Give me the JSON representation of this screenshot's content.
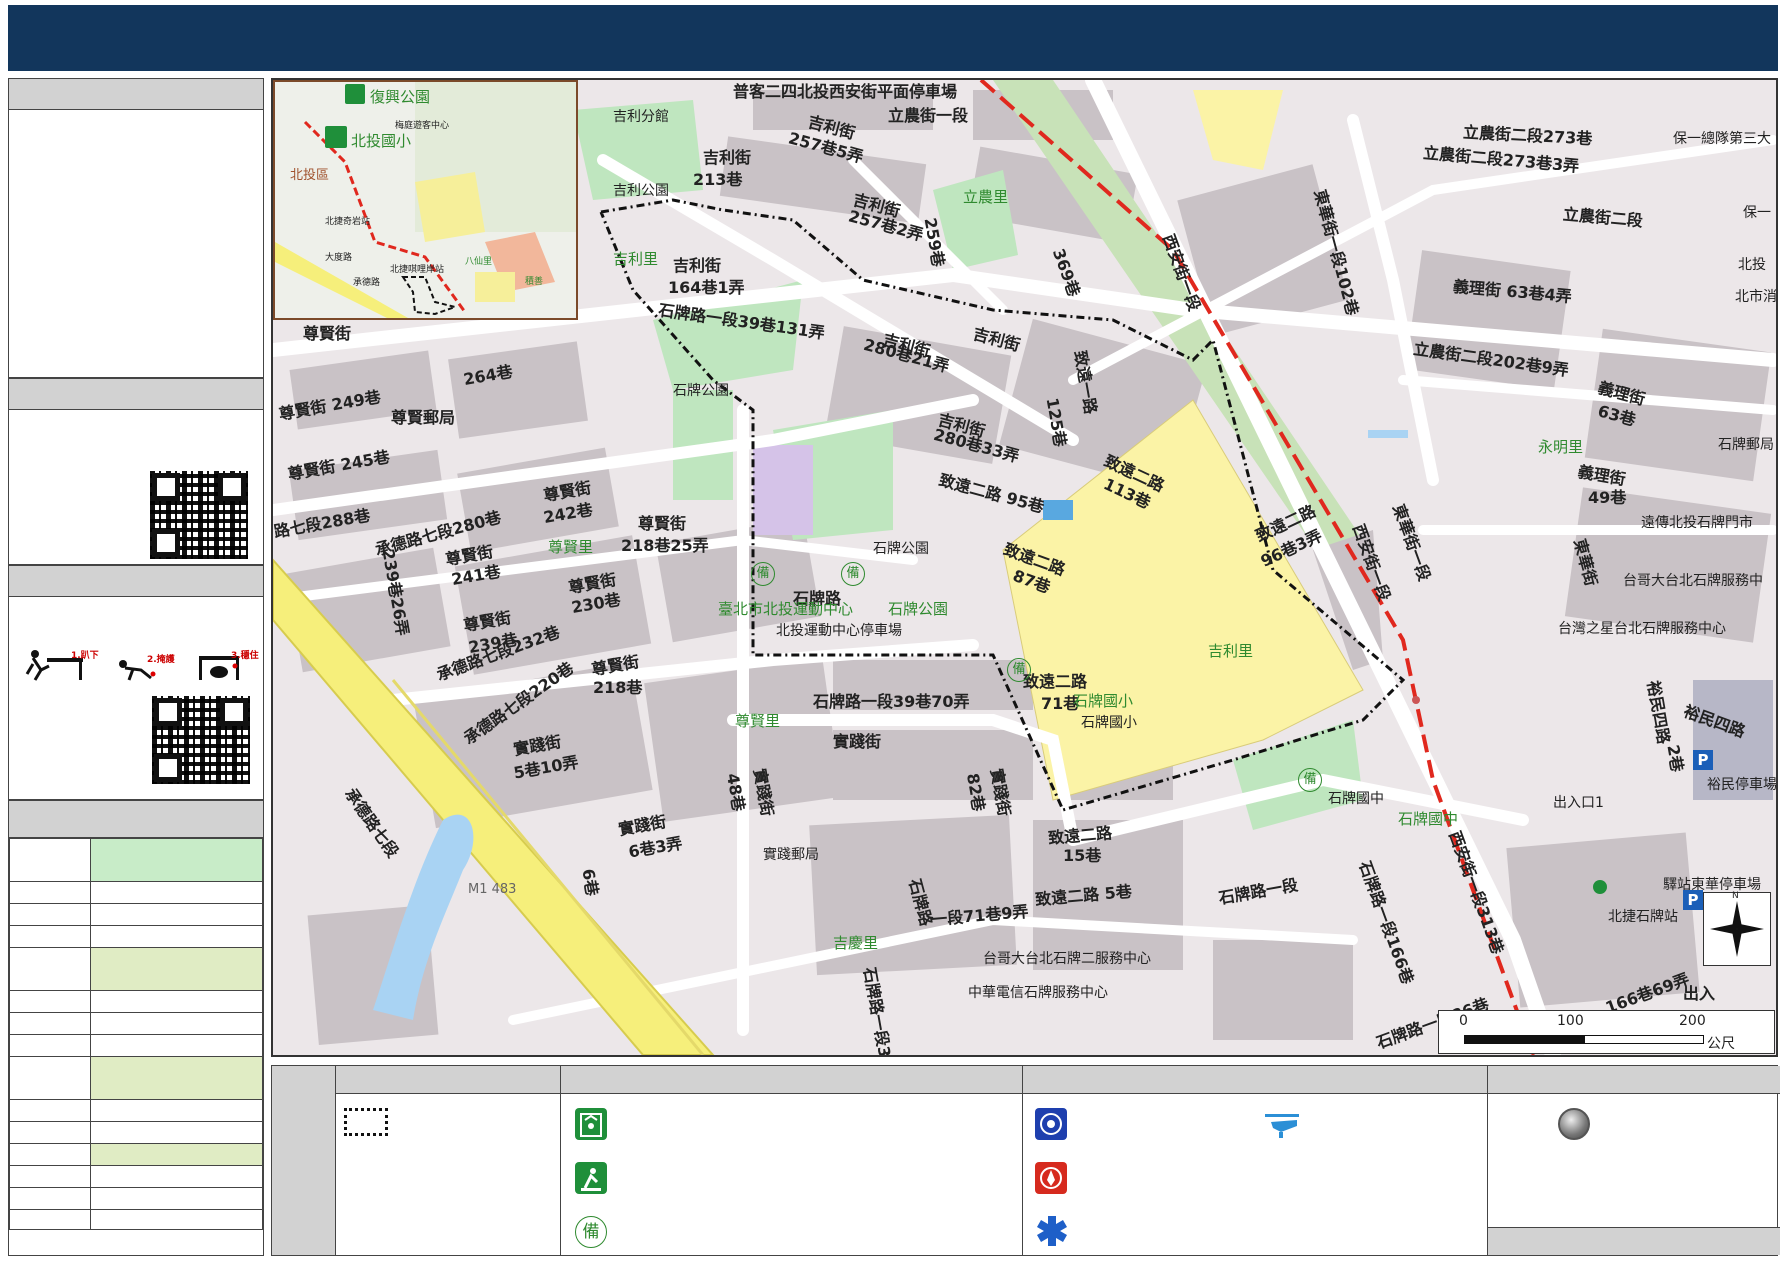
{
  "colors": {
    "header_bar": "#12365c",
    "panel_head": "#d2d2d2",
    "road_yellow": "#f6ef7b",
    "block_gray": "#c9c2c6",
    "school_yellow": "#fbf3a6",
    "park_green": "#bfe6bf",
    "route_red": "#e0281e",
    "shelter_green": "#1f8f3a",
    "police_blue": "#1e3fae",
    "fire_red": "#d62a1e",
    "schedule_green": "#c8ecc8",
    "schedule_olive": "#e0ecc4"
  },
  "icons": {
    "shelter": "shelter-icon",
    "park": "park-icon",
    "standby": "standby-icon",
    "police": "police-icon",
    "fire": "fire-icon",
    "medical": "medical-icon",
    "helicopter": "helicopter-icon",
    "gate": "exit-gate-icon",
    "compass": "north-arrow-icon",
    "parking": "parking-icon"
  },
  "drill_steps": [
    "1.趴下",
    "2.掩護",
    "3.穩住"
  ],
  "inset": {
    "labels": [
      "復興公園",
      "北投國小",
      "北投區",
      "北捷奇岩站",
      "大度路",
      "北捷唭哩岸站",
      "承德路",
      "八仙里",
      "積善",
      "梅庭遊客中心"
    ]
  },
  "map": {
    "scale": {
      "ticks": [
        "0",
        "100",
        "200"
      ],
      "unit": "公尺"
    },
    "compass_letter": "N",
    "labels": {
      "street": [
        "普客二四北投西安街平面停車場",
        "立農街一段",
        "吉利街",
        "257巷5弄",
        "吉利街",
        "213巷",
        "吉利街",
        "257巷2弄",
        "259巷",
        "立農里",
        "吉利里",
        "吉利街",
        "164巷1弄",
        "石牌路一段39巷131弄",
        "吉利街",
        "280巷21弄",
        "吉利街",
        "369巷",
        "致遠一路",
        "125巷",
        "尊賢街",
        "264巷",
        "尊賢街 249巷",
        "尊賢郵局",
        "尊賢街 245巷",
        "路七段288巷",
        "承德路七段280巷",
        "尊賢街",
        "241巷",
        "尊賢街",
        "242巷",
        "尊賢街",
        "218巷25弄",
        "尊賢里",
        "尊賢街",
        "230巷",
        "239巷26弄",
        "尊賢街",
        "239巷",
        "承德路七段232巷",
        "承德路七段220巷",
        "尊賢街",
        "218巷",
        "實踐街",
        "5巷10弄",
        "尊賢里",
        "實踐街",
        "6巷3弄",
        "實踐街",
        "48巷",
        "實踐郵局",
        "6巷",
        "吉慶里",
        "實踐街",
        "石牌路一段39巷70弄",
        "實踐街",
        "82巷",
        "致遠二路",
        "15巷",
        "致遠二路 5巷",
        "石牌路",
        "一段71巷9弄",
        "台哥大台北石牌二服務中心",
        "中華電信石牌服務中心",
        "石牌路一段3",
        "承德路七段",
        "M1 483",
        "吉利街",
        "280巷33弄",
        "致遠二路 95巷",
        "致遠二路",
        "113巷",
        "致遠二路",
        "87巷",
        "致遠二路",
        "96巷3弄",
        "石牌路",
        "北投運動中心停車場",
        "臺北市北投運動中心",
        "石牌公園",
        "石牌公園",
        "石牌公園",
        "致遠二路",
        "71巷",
        "石牌國小",
        "石牌國小",
        "吉利里",
        "石牌國中",
        "石牌國中",
        "石牌路一段",
        "石牌路一段166巷",
        "西安街一段313巷",
        "西安街一段",
        "東華街一段",
        "東華街一段102巷",
        "西安街一段",
        "立農街二段273巷",
        "立農街二段273巷3弄",
        "立農街二段",
        "保一總隊第三大",
        "保一",
        "義理街 63巷4弄",
        "北投",
        "北市消防",
        "立農街二段202巷9弄",
        "義理街",
        "63巷",
        "永明里",
        "石牌郵局",
        "義理街",
        "49巷",
        "遠傳北投石牌門市",
        "台哥大台北石牌服務中",
        "台灣之星台北石牌服務中心",
        "東華街",
        "裕民四路",
        "裕民四路",
        "2巷",
        "裕民停車場",
        "出入口1",
        "驛站東華停車場",
        "北捷石牌站",
        "166巷69弄",
        "出入",
        "石牌路一段86巷",
        "吉利分館",
        "吉利公園",
        "石牌公園",
        "石牌"
      ]
    }
  }
}
